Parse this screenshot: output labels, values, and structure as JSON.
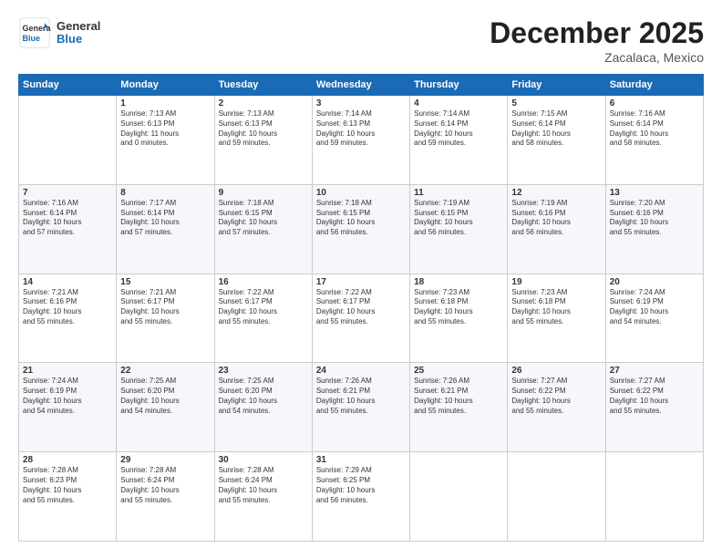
{
  "logo": {
    "line1": "General",
    "line2": "Blue"
  },
  "header": {
    "month_year": "December 2025",
    "location": "Zacalaca, Mexico"
  },
  "days_of_week": [
    "Sunday",
    "Monday",
    "Tuesday",
    "Wednesday",
    "Thursday",
    "Friday",
    "Saturday"
  ],
  "weeks": [
    [
      {
        "day": "",
        "info": ""
      },
      {
        "day": "1",
        "info": "Sunrise: 7:13 AM\nSunset: 6:13 PM\nDaylight: 11 hours\nand 0 minutes."
      },
      {
        "day": "2",
        "info": "Sunrise: 7:13 AM\nSunset: 6:13 PM\nDaylight: 10 hours\nand 59 minutes."
      },
      {
        "day": "3",
        "info": "Sunrise: 7:14 AM\nSunset: 6:13 PM\nDaylight: 10 hours\nand 59 minutes."
      },
      {
        "day": "4",
        "info": "Sunrise: 7:14 AM\nSunset: 6:14 PM\nDaylight: 10 hours\nand 59 minutes."
      },
      {
        "day": "5",
        "info": "Sunrise: 7:15 AM\nSunset: 6:14 PM\nDaylight: 10 hours\nand 58 minutes."
      },
      {
        "day": "6",
        "info": "Sunrise: 7:16 AM\nSunset: 6:14 PM\nDaylight: 10 hours\nand 58 minutes."
      }
    ],
    [
      {
        "day": "7",
        "info": "Sunrise: 7:16 AM\nSunset: 6:14 PM\nDaylight: 10 hours\nand 57 minutes."
      },
      {
        "day": "8",
        "info": "Sunrise: 7:17 AM\nSunset: 6:14 PM\nDaylight: 10 hours\nand 57 minutes."
      },
      {
        "day": "9",
        "info": "Sunrise: 7:18 AM\nSunset: 6:15 PM\nDaylight: 10 hours\nand 57 minutes."
      },
      {
        "day": "10",
        "info": "Sunrise: 7:18 AM\nSunset: 6:15 PM\nDaylight: 10 hours\nand 56 minutes."
      },
      {
        "day": "11",
        "info": "Sunrise: 7:19 AM\nSunset: 6:15 PM\nDaylight: 10 hours\nand 56 minutes."
      },
      {
        "day": "12",
        "info": "Sunrise: 7:19 AM\nSunset: 6:16 PM\nDaylight: 10 hours\nand 56 minutes."
      },
      {
        "day": "13",
        "info": "Sunrise: 7:20 AM\nSunset: 6:16 PM\nDaylight: 10 hours\nand 55 minutes."
      }
    ],
    [
      {
        "day": "14",
        "info": "Sunrise: 7:21 AM\nSunset: 6:16 PM\nDaylight: 10 hours\nand 55 minutes."
      },
      {
        "day": "15",
        "info": "Sunrise: 7:21 AM\nSunset: 6:17 PM\nDaylight: 10 hours\nand 55 minutes."
      },
      {
        "day": "16",
        "info": "Sunrise: 7:22 AM\nSunset: 6:17 PM\nDaylight: 10 hours\nand 55 minutes."
      },
      {
        "day": "17",
        "info": "Sunrise: 7:22 AM\nSunset: 6:17 PM\nDaylight: 10 hours\nand 55 minutes."
      },
      {
        "day": "18",
        "info": "Sunrise: 7:23 AM\nSunset: 6:18 PM\nDaylight: 10 hours\nand 55 minutes."
      },
      {
        "day": "19",
        "info": "Sunrise: 7:23 AM\nSunset: 6:18 PM\nDaylight: 10 hours\nand 55 minutes."
      },
      {
        "day": "20",
        "info": "Sunrise: 7:24 AM\nSunset: 6:19 PM\nDaylight: 10 hours\nand 54 minutes."
      }
    ],
    [
      {
        "day": "21",
        "info": "Sunrise: 7:24 AM\nSunset: 6:19 PM\nDaylight: 10 hours\nand 54 minutes."
      },
      {
        "day": "22",
        "info": "Sunrise: 7:25 AM\nSunset: 6:20 PM\nDaylight: 10 hours\nand 54 minutes."
      },
      {
        "day": "23",
        "info": "Sunrise: 7:25 AM\nSunset: 6:20 PM\nDaylight: 10 hours\nand 54 minutes."
      },
      {
        "day": "24",
        "info": "Sunrise: 7:26 AM\nSunset: 6:21 PM\nDaylight: 10 hours\nand 55 minutes."
      },
      {
        "day": "25",
        "info": "Sunrise: 7:26 AM\nSunset: 6:21 PM\nDaylight: 10 hours\nand 55 minutes."
      },
      {
        "day": "26",
        "info": "Sunrise: 7:27 AM\nSunset: 6:22 PM\nDaylight: 10 hours\nand 55 minutes."
      },
      {
        "day": "27",
        "info": "Sunrise: 7:27 AM\nSunset: 6:22 PM\nDaylight: 10 hours\nand 55 minutes."
      }
    ],
    [
      {
        "day": "28",
        "info": "Sunrise: 7:28 AM\nSunset: 6:23 PM\nDaylight: 10 hours\nand 55 minutes."
      },
      {
        "day": "29",
        "info": "Sunrise: 7:28 AM\nSunset: 6:24 PM\nDaylight: 10 hours\nand 55 minutes."
      },
      {
        "day": "30",
        "info": "Sunrise: 7:28 AM\nSunset: 6:24 PM\nDaylight: 10 hours\nand 55 minutes."
      },
      {
        "day": "31",
        "info": "Sunrise: 7:29 AM\nSunset: 6:25 PM\nDaylight: 10 hours\nand 56 minutes."
      },
      {
        "day": "",
        "info": ""
      },
      {
        "day": "",
        "info": ""
      },
      {
        "day": "",
        "info": ""
      }
    ]
  ]
}
